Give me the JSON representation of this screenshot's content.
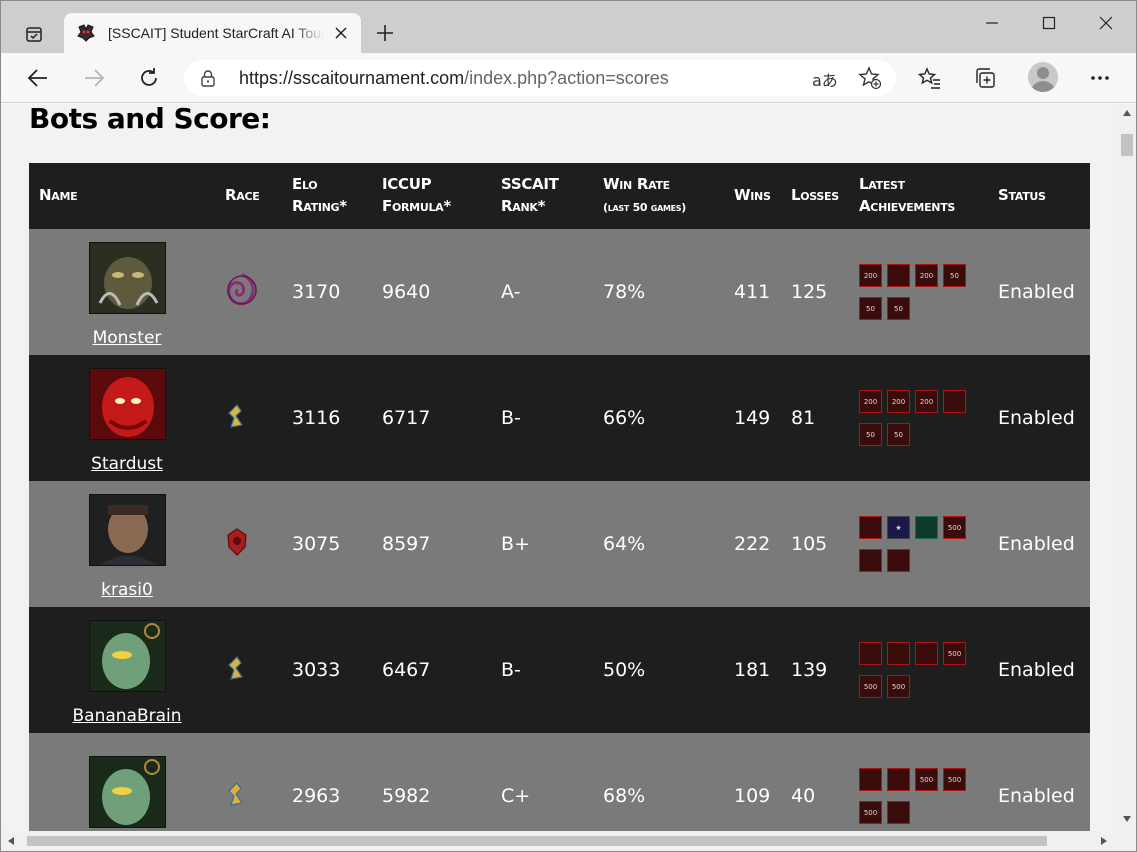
{
  "browser": {
    "tab_title": "[SSCAIT] Student StarCraft AI Tournament",
    "url_host": "https://sscaitournament.com",
    "url_path": "/index.php?action=scores",
    "read_aloud_label": "aあ"
  },
  "page": {
    "heading": "Bots and Score:"
  },
  "table": {
    "headers": {
      "name": "Name",
      "race": "Race",
      "elo_line1": "Elo",
      "elo_line2": "Rating*",
      "iccup_line1": "ICCUP",
      "iccup_line2": "Formula*",
      "sscait_line1": "SSCAIT",
      "sscait_line2": "Rank*",
      "winrate_line1": "Win Rate",
      "winrate_line2": "(last 50 games)",
      "wins": "Wins",
      "losses": "Losses",
      "ach_line1": "Latest",
      "ach_line2": "Achievements",
      "status": "Status"
    },
    "rows": [
      {
        "name": "Monster",
        "race": "zerg-icon",
        "elo": "3170",
        "iccup": "9640",
        "rank": "A-",
        "winrate": "78%",
        "wins": "411",
        "losses": "125",
        "status": "Enabled",
        "achievements": [
          "200",
          "",
          "200",
          "50",
          "50",
          "50"
        ]
      },
      {
        "name": "Stardust",
        "race": "protoss-icon",
        "elo": "3116",
        "iccup": "6717",
        "rank": "B-",
        "winrate": "66%",
        "wins": "149",
        "losses": "81",
        "status": "Enabled",
        "achievements": [
          "200",
          "200",
          "200",
          "",
          "50",
          "50"
        ]
      },
      {
        "name": "krasi0",
        "race": "terran-icon",
        "elo": "3075",
        "iccup": "8597",
        "rank": "B+",
        "winrate": "64%",
        "wins": "222",
        "losses": "105",
        "status": "Enabled",
        "achievements": [
          "",
          "★",
          "",
          "500",
          "",
          ""
        ]
      },
      {
        "name": "BananaBrain",
        "race": "protoss-icon",
        "elo": "3033",
        "iccup": "6467",
        "rank": "B-",
        "winrate": "50%",
        "wins": "181",
        "losses": "139",
        "status": "Enabled",
        "achievements": [
          "",
          "",
          "",
          "500",
          "500",
          "500"
        ]
      },
      {
        "name": "",
        "race": "protoss-icon",
        "elo": "2963",
        "iccup": "5982",
        "rank": "C+",
        "winrate": "68%",
        "wins": "109",
        "losses": "40",
        "status": "Enabled",
        "achievements": [
          "",
          "",
          "500",
          "500",
          "500",
          ""
        ]
      }
    ]
  },
  "colors": {
    "header_bg": "#1e1e1e",
    "row_light": "#7a7a7a",
    "row_dark": "#1e1e1e",
    "status_enabled": "#5fc24a",
    "achievement_border": "#b01515"
  }
}
